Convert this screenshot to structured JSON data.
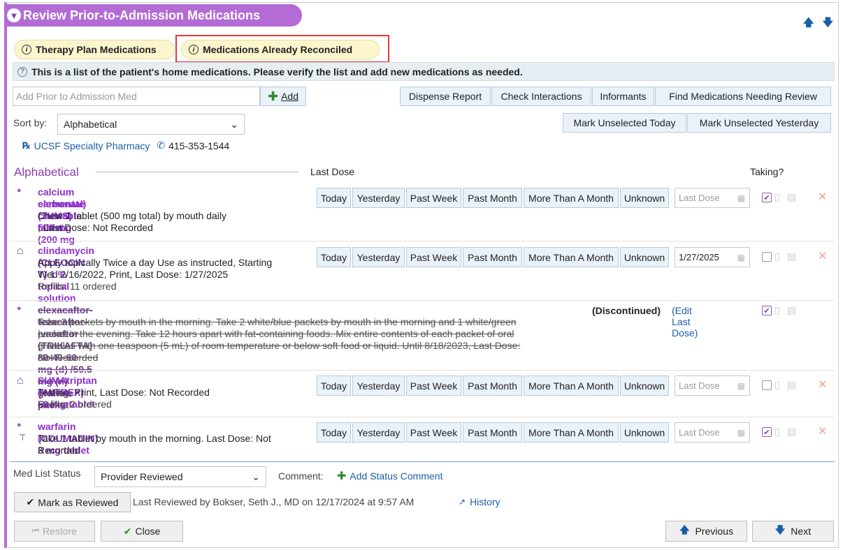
{
  "title": "Review Prior-to-Admission Medications",
  "nav_arrows": "🡅 🡇",
  "pills": {
    "therapy": "Therapy Plan Medications",
    "reconciled": "Medications Already Reconciled"
  },
  "info_text": "This is a list of the patient's home medications. Please verify the list and add new medications as needed.",
  "add_input_placeholder": "Add Prior to Admission Med",
  "add_button": "Add",
  "toolbar": {
    "dispense": "Dispense Report",
    "interactions": "Check Interactions",
    "informants": "Informants",
    "find": "Find Medications Needing Review"
  },
  "sort": {
    "label": "Sort by:",
    "value": "Alphabetical"
  },
  "mark": {
    "today": "Mark Unselected Today",
    "yesterday": "Mark Unselected Yesterday"
  },
  "pharmacy": {
    "name": "UCSF Specialty Pharmacy",
    "phone": "415-353-1544"
  },
  "section": {
    "title": "Alphabetical",
    "last_dose": "Last Dose",
    "taking": "Taking?"
  },
  "dose_buttons": [
    "Today",
    "Yesterday",
    "Past Week",
    "Past Month",
    "More Than A Month",
    "Unknown"
  ],
  "last_dose_placeholder": "Last Dose",
  "meds": [
    {
      "name_1": "calcium carbonate (TUMS) 500 mg (200 mg",
      "name_2": "elemental) chewable tablet",
      "sig_1": "Chew 1 tablet (500 mg total) by mouth daily",
      "sig_2": ", Last Dose: Not Recorded",
      "last_dose": "",
      "taking": true
    },
    {
      "name_1": "clindamycin (CLEOCIN T) 1 % topical solution",
      "sig_1": "Apply topically Twice a day Use as instructed, Starting",
      "sig_2": "Wed 2/16/2022, Print, Last Dose: 1/27/2025",
      "sig_3": "Refills: 11 ordered",
      "last_dose": "1/27/2025",
      "taking": false
    },
    {
      "name_1": "elexacaftor-tezacaftor-ivacaftor (TRIKAFTA) 80-40-60 mg (d) /59.5 mg (n) granule packet",
      "sig_1": "Take 3 packets by mouth in the morning. Take 2 white/blue packets by mouth in the morning and 1 white/green",
      "sig_2": "packet in the evening. Take 12 hours apart with fat-containing foods. Mix entire contents of each packet of oral",
      "sig_3": "granules with one teaspoon (5 mL) of room temperature or below soft food or liquid. Until 8/18/2023, Last Dose:",
      "sig_4": "Not Recorded",
      "status": "(Discontinued)",
      "edit_link": "(Edit Last Dose)",
      "taking": true
    },
    {
      "name_1": "SUMAtriptan (IMITREX) 50 mg tablet",
      "sig_1": "Testing, Print, Last Dose: Not Recorded",
      "sig_2": "Refills: 2 ordered",
      "last_dose": "",
      "taking": false
    },
    {
      "name_1": "warfarin (COUMADIN) 3 mg tablet",
      "sig_1": "Take 1 tablet by mouth in the morning. Last Dose: Not",
      "sig_2": "Recorded",
      "last_dose": "",
      "taking": true
    }
  ],
  "status": {
    "label": "Med List Status",
    "value": "Provider Reviewed",
    "comment_label": "Comment:",
    "add_comment": "Add Status Comment"
  },
  "review": {
    "button": "Mark as Reviewed",
    "last_reviewed": "Last Reviewed by Bokser, Seth J., MD on 12/17/2024 at 9:57 AM",
    "history": "History"
  },
  "footer": {
    "restore": "Restore",
    "close": "Close",
    "previous": "Previous",
    "next": "Next"
  },
  "colors": {
    "accent": "#b36bd6",
    "drug": "#8b2fc9",
    "link": "#1a5ea8",
    "highlight": "#e53935"
  }
}
